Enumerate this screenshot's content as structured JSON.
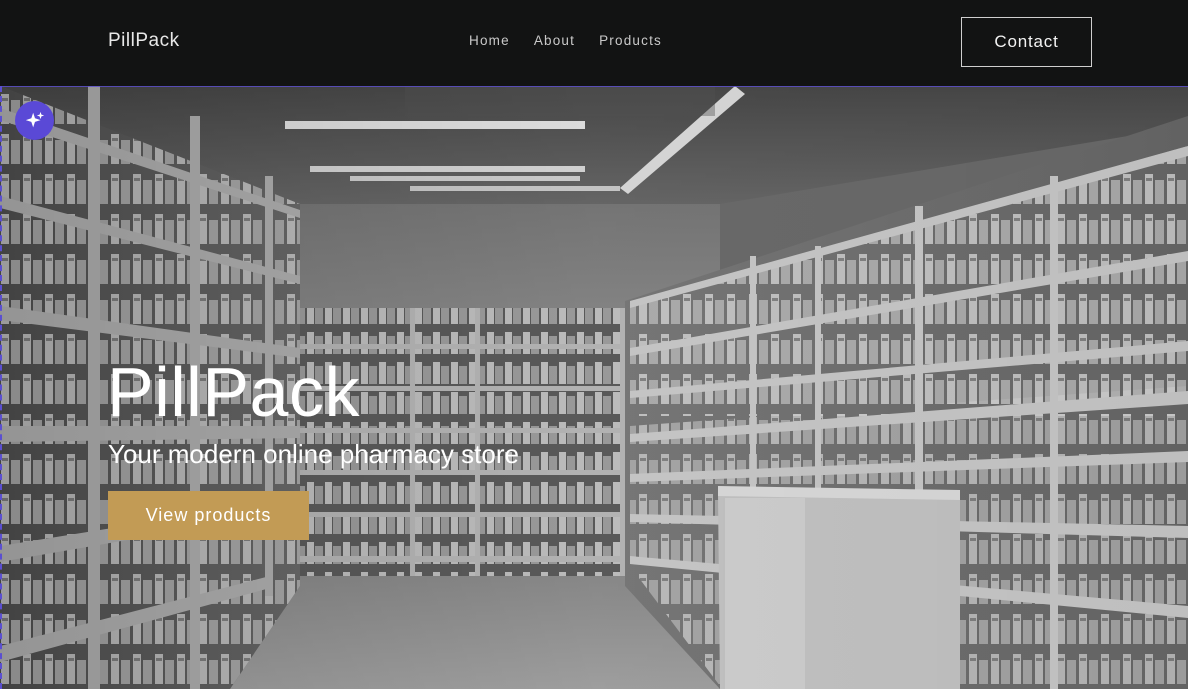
{
  "header": {
    "brand": "PillPack",
    "nav": [
      {
        "label": "Home"
      },
      {
        "label": "About"
      },
      {
        "label": "Products"
      }
    ],
    "contact_label": "Contact"
  },
  "hero": {
    "title": "PillPack",
    "subtitle": "Your modern online pharmacy store",
    "cta_label": "View products",
    "background_image": "grayscale pharmacy store interior with shelves of medicine"
  },
  "icons": {
    "ai_badge": "sparkle-icon"
  },
  "colors": {
    "header_bg": "#121313",
    "cta_bg": "#c29b55",
    "ai_badge_bg": "#5a49d6",
    "selection_outline": "#5b4fd1"
  }
}
